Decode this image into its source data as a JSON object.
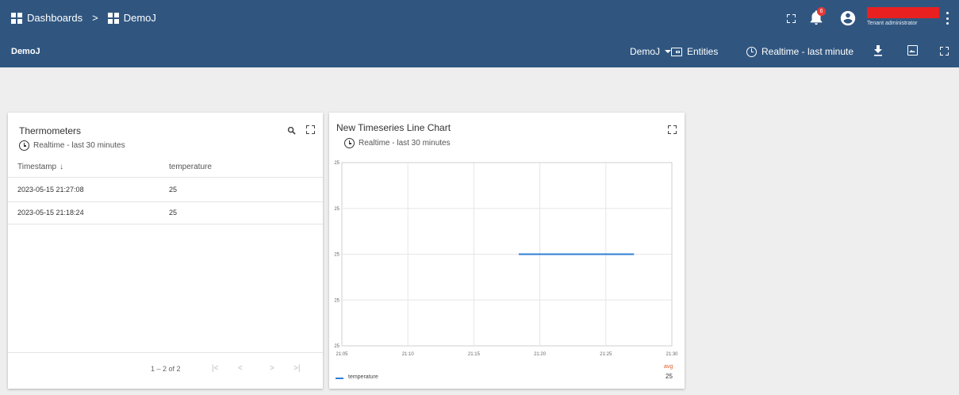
{
  "breadcrumb": {
    "root_label": "Dashboards",
    "separator": ">",
    "current_label": "DemoJ"
  },
  "header": {
    "notification_count": "6",
    "user_role": "Tenant administrator",
    "user_name_redacted_color": "#e82020"
  },
  "toolbar": {
    "dashboard_title": "DemoJ",
    "state_selector_label": "DemoJ",
    "entities_label": "Entities",
    "timewindow_label": "Realtime - last minute"
  },
  "colors": {
    "header_bg": "#305680",
    "page_bg": "#eeeeee",
    "series": "#2f7fd4",
    "legend_agg": "#e05a2b",
    "notification_badge": "#e53935"
  },
  "thermometers_widget": {
    "title": "Thermometers",
    "timewindow": "Realtime - last 30 minutes",
    "columns": [
      "Timestamp",
      "temperature"
    ],
    "sort_indicator": "↓",
    "rows": [
      {
        "timestamp": "2023-05-15 21:27:08",
        "temperature": "25"
      },
      {
        "timestamp": "2023-05-15 21:18:24",
        "temperature": "25"
      }
    ],
    "pagination_text": "1 – 2 of 2"
  },
  "chart_widget": {
    "title": "New Timeseries Line Chart",
    "timewindow": "Realtime - last 30 minutes",
    "legend_agg_label": "avg",
    "legend_series_name": "temperature",
    "legend_avg_value": "25"
  },
  "chart_data": {
    "type": "line",
    "title": "New Timeseries Line Chart",
    "xlabel": "",
    "ylabel": "",
    "x_ticks": [
      "21:05",
      "21:10",
      "21:15",
      "21:20",
      "21:25",
      "21:30"
    ],
    "y_ticks": [
      "25",
      "25",
      "25",
      "25",
      "25"
    ],
    "ylim": [
      24,
      26
    ],
    "grid": true,
    "legend_position": "bottom-left",
    "series": [
      {
        "name": "temperature",
        "color": "#2f7fd4",
        "points": [
          {
            "x": "21:18:24",
            "y": 25
          },
          {
            "x": "21:27:08",
            "y": 25
          }
        ]
      }
    ]
  }
}
